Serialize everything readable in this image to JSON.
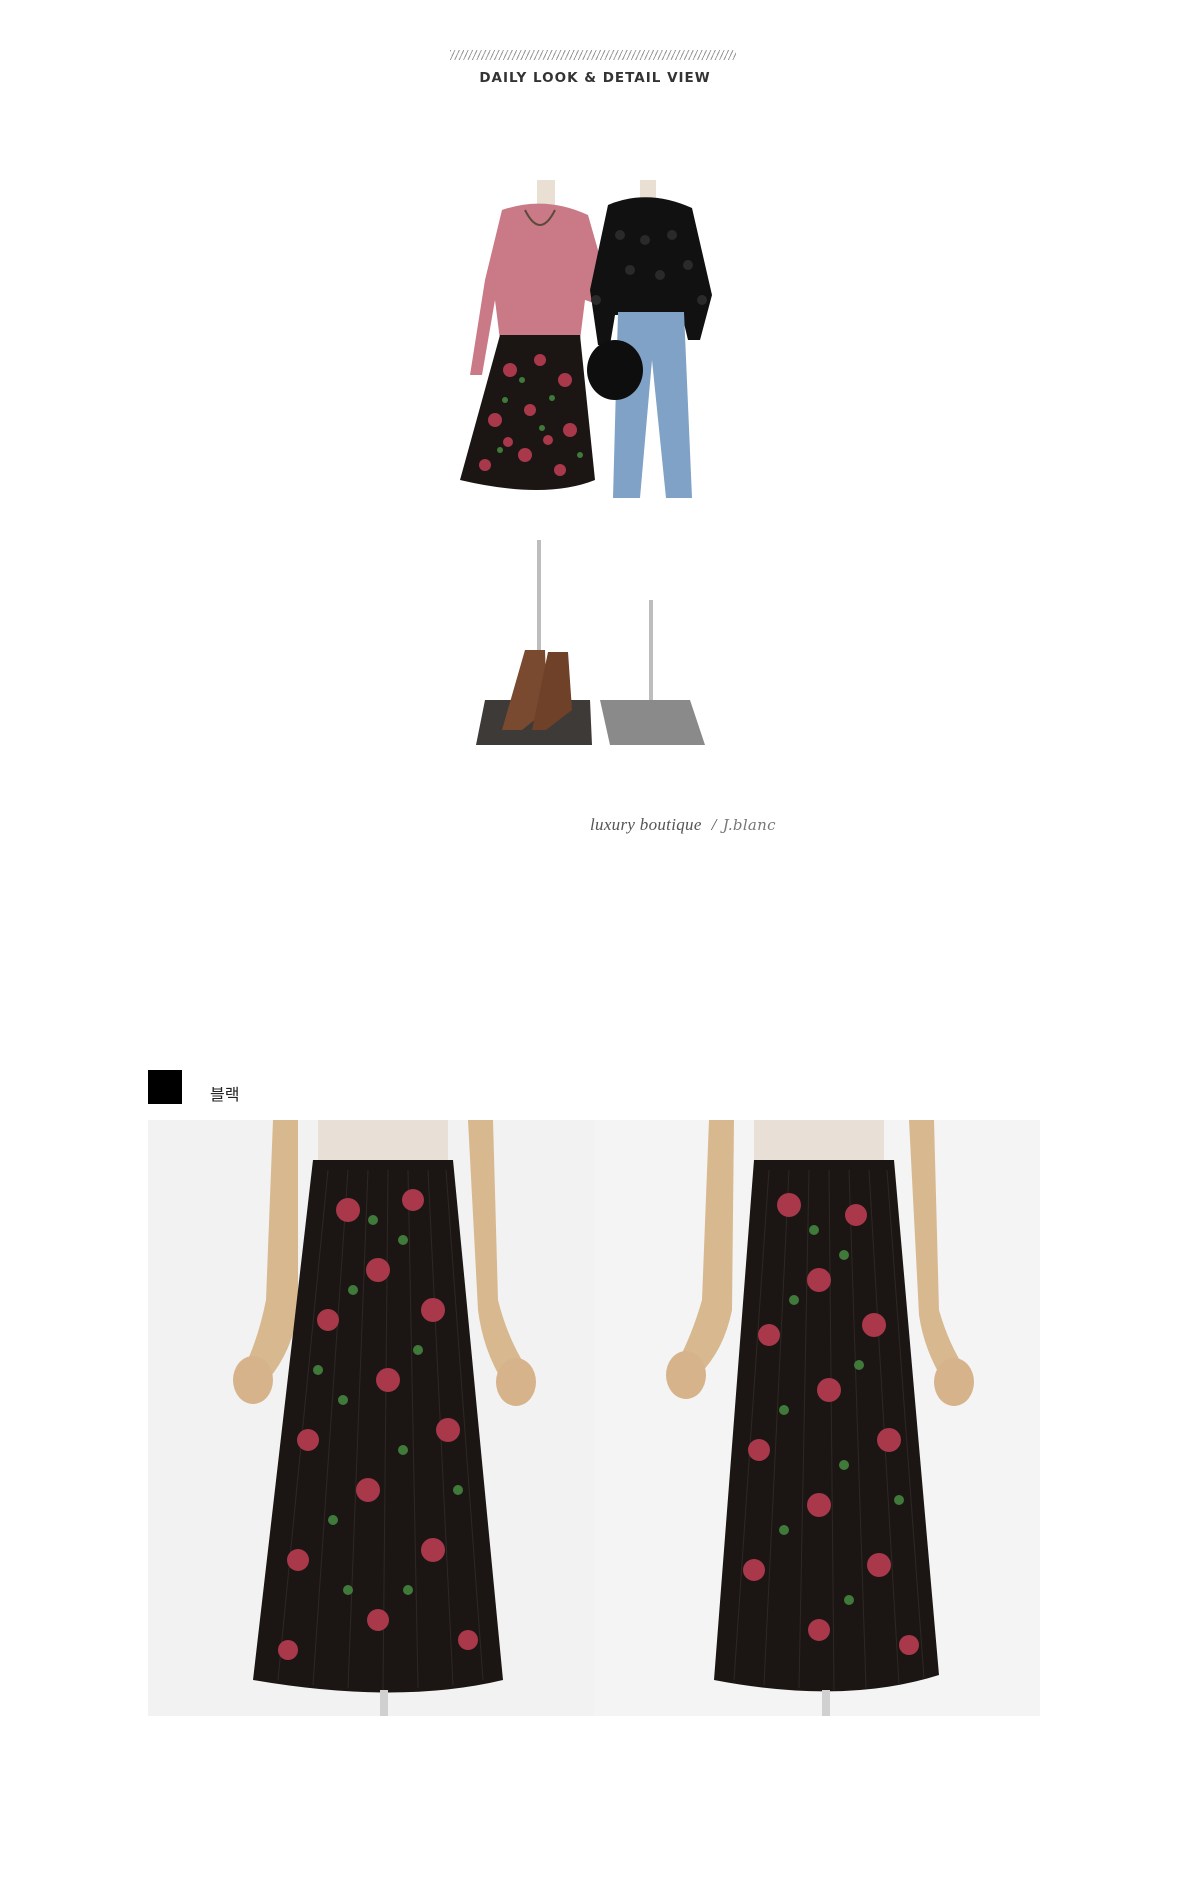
{
  "header": {
    "title": "DAILY LOOK & DETAIL VIEW"
  },
  "look": {
    "caption_text": "luxury boutique",
    "caption_separator": "/",
    "caption_signature": "J.blanc"
  },
  "color_option": {
    "swatch_color": "#000000",
    "label": "블랙"
  },
  "colors": {
    "skirt_base": "#1b1614",
    "rose": "#a8384a",
    "leaf": "#3f7a3a",
    "sweater_pink": "#c97a86",
    "denim": "#7fa2c6",
    "boots": "#7a4a30",
    "mannequin_wood": "#d8b98f"
  }
}
